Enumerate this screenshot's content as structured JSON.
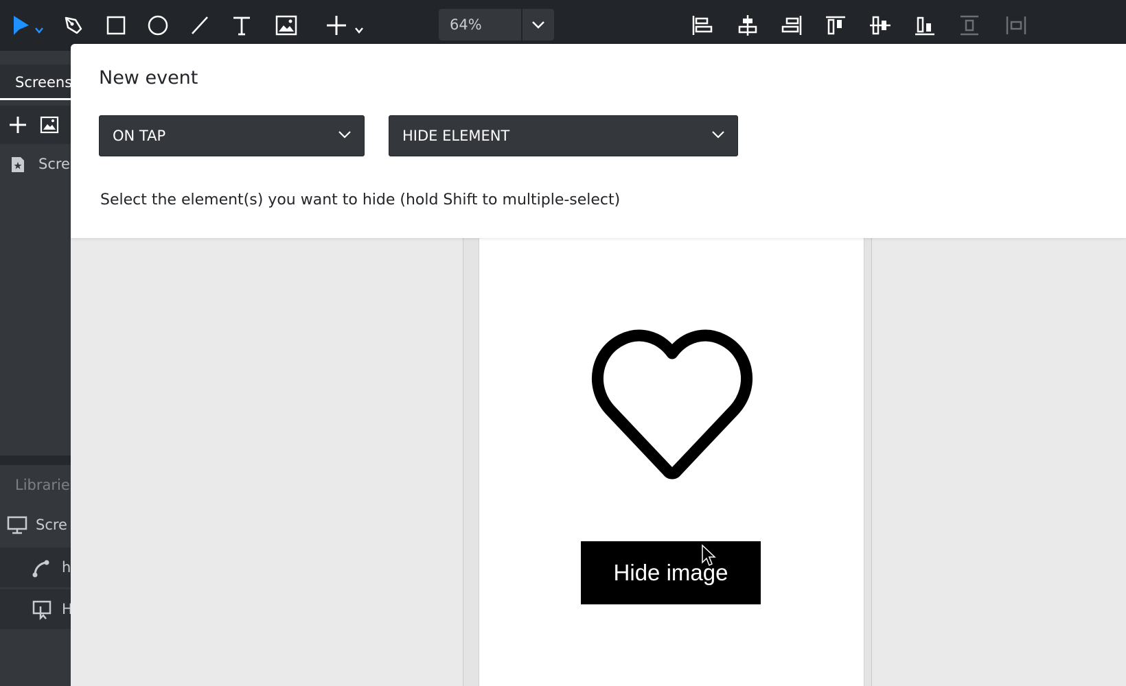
{
  "toolbar": {
    "tools": [
      {
        "name": "select-tool",
        "icon": "pointer-icon",
        "active": true
      },
      {
        "name": "pen-tool",
        "icon": "pen-icon"
      },
      {
        "name": "rectangle-tool",
        "icon": "rectangle-icon"
      },
      {
        "name": "ellipse-tool",
        "icon": "ellipse-icon"
      },
      {
        "name": "line-tool",
        "icon": "line-icon"
      },
      {
        "name": "text-tool",
        "icon": "text-icon"
      },
      {
        "name": "image-tool",
        "icon": "image-icon"
      },
      {
        "name": "add-tool",
        "icon": "plus-icon"
      }
    ],
    "zoom_value": "64%",
    "align_tools": [
      "align-left-icon",
      "align-center-horizontal-icon",
      "align-right-icon",
      "align-top-icon",
      "align-middle-vertical-icon",
      "align-bottom-icon",
      "distribute-vertical-icon",
      "distribute-horizontal-icon"
    ],
    "accent_color": "#1e90ff"
  },
  "sidebar": {
    "tab_label": "Screens",
    "screen_item": "Scre",
    "libraries_label": "Librarie",
    "library_items": [
      {
        "label": "Scre",
        "icon": "monitor-icon"
      },
      {
        "label": "h",
        "icon": "hotspot-icon"
      },
      {
        "label": "H",
        "icon": "button-icon"
      }
    ]
  },
  "panel": {
    "title": "New event",
    "trigger_value": "ON TAP",
    "action_value": "HIDE ELEMENT",
    "hint": "Select the element(s) you want to hide (hold Shift to multiple-select)"
  },
  "canvas": {
    "button_label": "Hide image",
    "background": "#eaeaea"
  }
}
